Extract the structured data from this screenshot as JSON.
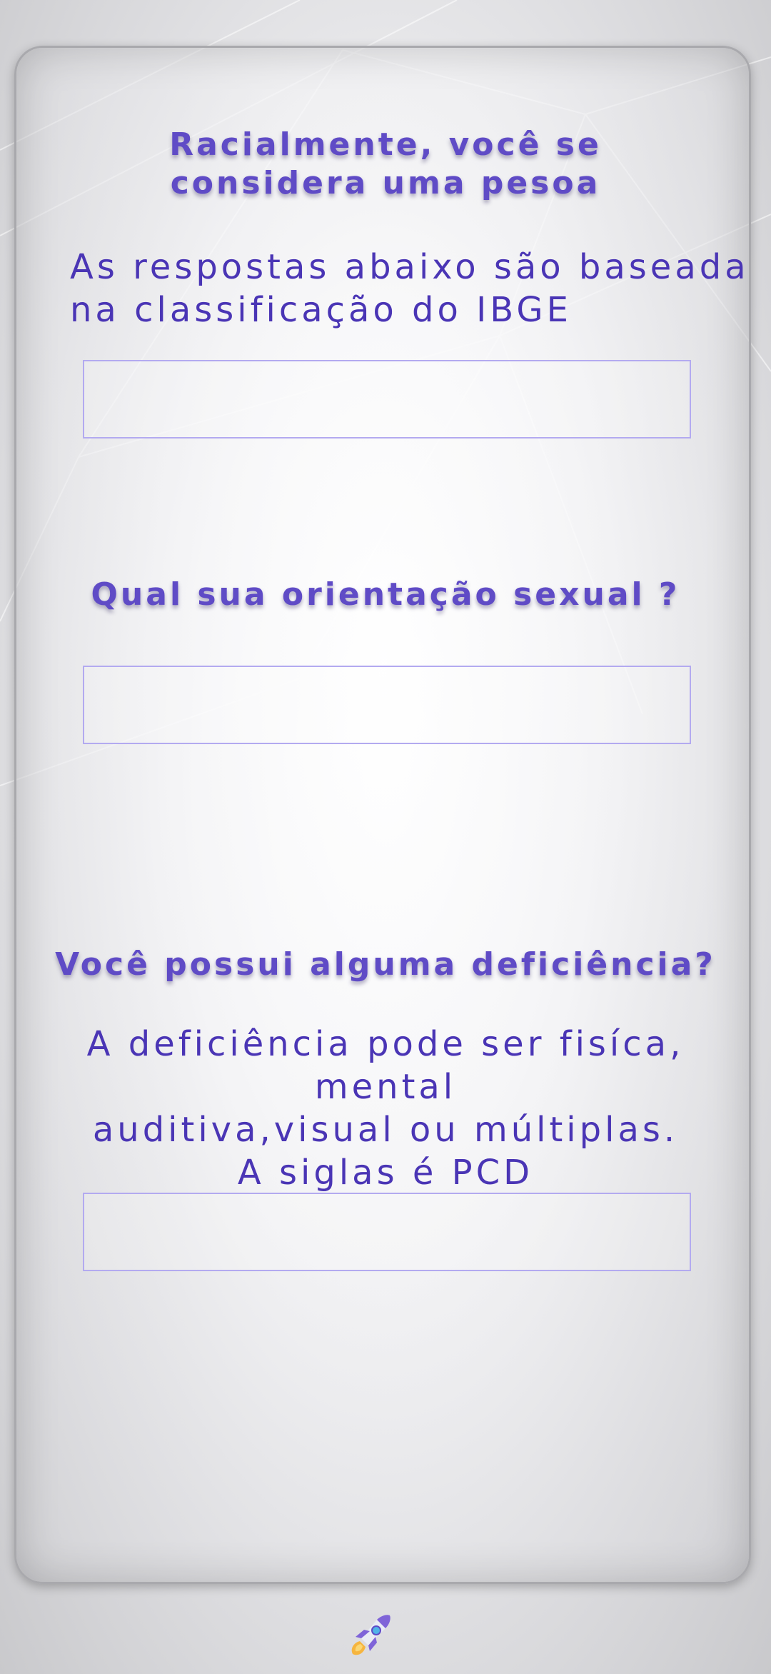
{
  "section1": {
    "heading": "Racialmente, você se\nconsidera uma pesoa",
    "subtext": "As respostas abaixo são baseada\nna classificação do IBGE",
    "field_value": ""
  },
  "section2": {
    "heading": "Qual sua orientação sexual ?",
    "field_value": ""
  },
  "section3": {
    "heading": "Você possui alguma deficiência?",
    "subtext": "A deficiência pode ser fisíca, mental\nauditiva,visual ou múltiplas.\nA siglas é PCD",
    "field_value": ""
  },
  "footer": {
    "icon": "rocket-icon"
  },
  "colors": {
    "accent": "#5f4bc6",
    "text": "#4a35b5",
    "field_border": "#b3aaf0"
  }
}
